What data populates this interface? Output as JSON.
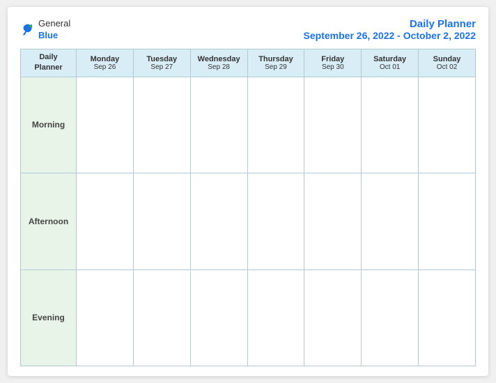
{
  "logo": {
    "general": "General",
    "blue": "Blue"
  },
  "header": {
    "title": "Daily Planner",
    "date_range": "September 26, 2022 - October 2, 2022"
  },
  "table": {
    "col_header_first_line1": "Daily",
    "col_header_first_line2": "Planner",
    "columns": [
      {
        "day": "Monday",
        "date": "Sep 26"
      },
      {
        "day": "Tuesday",
        "date": "Sep 27"
      },
      {
        "day": "Wednesday",
        "date": "Sep 28"
      },
      {
        "day": "Thursday",
        "date": "Sep 29"
      },
      {
        "day": "Friday",
        "date": "Sep 30"
      },
      {
        "day": "Saturday",
        "date": "Oct 01"
      },
      {
        "day": "Sunday",
        "date": "Oct 02"
      }
    ],
    "rows": [
      "Morning",
      "Afternoon",
      "Evening"
    ]
  }
}
